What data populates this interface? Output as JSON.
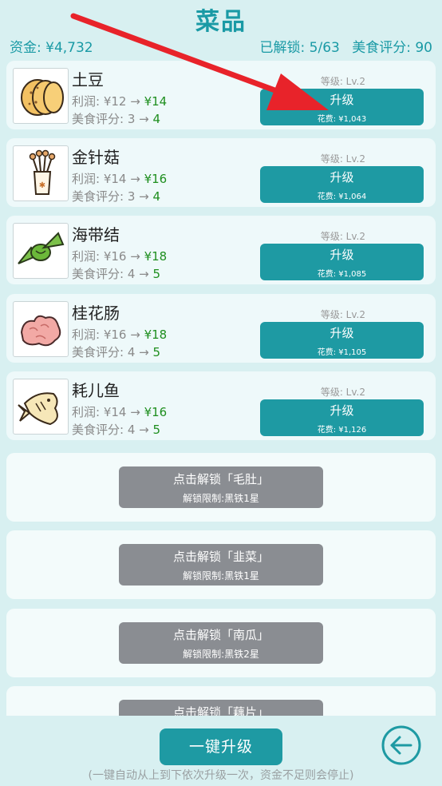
{
  "header": {
    "title": "菜品",
    "money": "资金: ¥4,732",
    "unlocked": "已解锁: 5/63",
    "rating": "美食评分: 90"
  },
  "dishes": [
    {
      "name": "土豆",
      "profit_label": "利润: ¥12 → ",
      "profit_new": "¥14",
      "rating_label": "美食评分: 3 → ",
      "rating_new": "4",
      "level": "等级: Lv.2",
      "button": "升级",
      "cost": "花费: ¥1,043",
      "icon": "potato-icon"
    },
    {
      "name": "金针菇",
      "profit_label": "利润: ¥14 → ",
      "profit_new": "¥16",
      "rating_label": "美食评分: 3 → ",
      "rating_new": "4",
      "level": "等级: Lv.2",
      "button": "升级",
      "cost": "花费: ¥1,064",
      "icon": "enoki-mushroom-icon"
    },
    {
      "name": "海带结",
      "profit_label": "利润: ¥16 → ",
      "profit_new": "¥18",
      "rating_label": "美食评分: 4 → ",
      "rating_new": "5",
      "level": "等级: Lv.2",
      "button": "升级",
      "cost": "花费: ¥1,085",
      "icon": "kelp-knot-icon"
    },
    {
      "name": "桂花肠",
      "profit_label": "利润: ¥16 → ",
      "profit_new": "¥18",
      "rating_label": "美食评分: 4 → ",
      "rating_new": "5",
      "level": "等级: Lv.2",
      "button": "升级",
      "cost": "花费: ¥1,105",
      "icon": "sausage-icon"
    },
    {
      "name": "耗儿鱼",
      "profit_label": "利润: ¥14 → ",
      "profit_new": "¥16",
      "rating_label": "美食评分: 4 → ",
      "rating_new": "5",
      "level": "等级: Lv.2",
      "button": "升级",
      "cost": "花费: ¥1,126",
      "icon": "fish-icon"
    }
  ],
  "locked": [
    {
      "label": "点击解锁「毛肚」",
      "requirement": "解锁限制:黑铁1星"
    },
    {
      "label": "点击解锁「韭菜」",
      "requirement": "解锁限制:黑铁1星"
    },
    {
      "label": "点击解锁「南瓜」",
      "requirement": "解锁限制:黑铁2星"
    },
    {
      "label": "点击解锁「藕片」",
      "requirement": ""
    }
  ],
  "footer": {
    "upgrade_all": "一键升级",
    "note": "(一键自动从上到下依次升级一次，资金不足则会停止)",
    "back_icon": "back-arrow-icon"
  },
  "colors": {
    "accent": "#1e9aa3",
    "locked": "#8a8d92",
    "profit_up": "#1e8e1e",
    "annotation_arrow": "#e8232a"
  }
}
